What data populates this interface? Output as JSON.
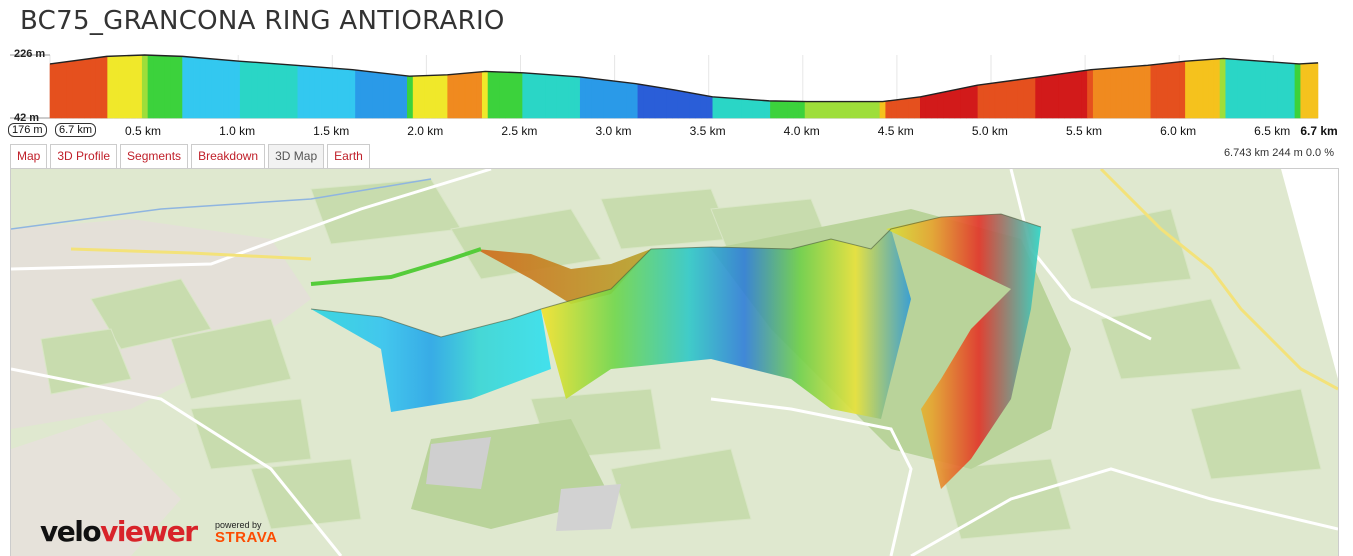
{
  "page": {
    "title": "BC75_GRANCONA RING ANTIORARIO"
  },
  "profile": {
    "y_max_label": "226 m",
    "y_min_label": "42 m",
    "cursor_elev": "176 m",
    "cursor_dist": "6.7 km",
    "x_ticks": [
      "0.5 km",
      "1.0 km",
      "1.5 km",
      "2.0 km",
      "2.5 km",
      "3.0 km",
      "3.5 km",
      "4.0 km",
      "4.5 km",
      "5.0 km",
      "5.5 km",
      "6.0 km",
      "6.5 km"
    ],
    "x_end": "6.7 km"
  },
  "chart_data": {
    "type": "area",
    "x": [
      0,
      0.3,
      0.5,
      0.7,
      1.0,
      1.3,
      1.6,
      1.9,
      2.1,
      2.3,
      2.5,
      2.8,
      3.1,
      3.3,
      3.5,
      3.8,
      4.0,
      4.4,
      4.6,
      4.9,
      5.2,
      5.5,
      5.8,
      6.0,
      6.2,
      6.4,
      6.6,
      6.7
    ],
    "values": [
      200,
      222,
      226,
      222,
      208,
      196,
      183,
      164,
      168,
      178,
      174,
      162,
      142,
      124,
      104,
      92,
      90,
      90,
      104,
      138,
      160,
      183,
      196,
      208,
      216,
      208,
      200,
      203
    ],
    "ylim": [
      42,
      226
    ],
    "xlim": [
      0,
      6.7
    ]
  },
  "tabs": [
    {
      "label": "Map",
      "active": false
    },
    {
      "label": "3D Profile",
      "active": false
    },
    {
      "label": "Segments",
      "active": false
    },
    {
      "label": "Breakdown",
      "active": false
    },
    {
      "label": "3D Map",
      "active": true
    },
    {
      "label": "Earth",
      "active": false
    }
  ],
  "stats": "6.743 km 244 m 0.0 %",
  "branding": {
    "logo_part1": "velo",
    "logo_part2": "viewer",
    "powered_by": "powered by",
    "strava": "STRAVA"
  },
  "colors": {
    "tab_text": "#c0202a",
    "map_bg": "#dfe8cf",
    "logo_red": "#d8232a",
    "strava": "#fc4c02"
  }
}
